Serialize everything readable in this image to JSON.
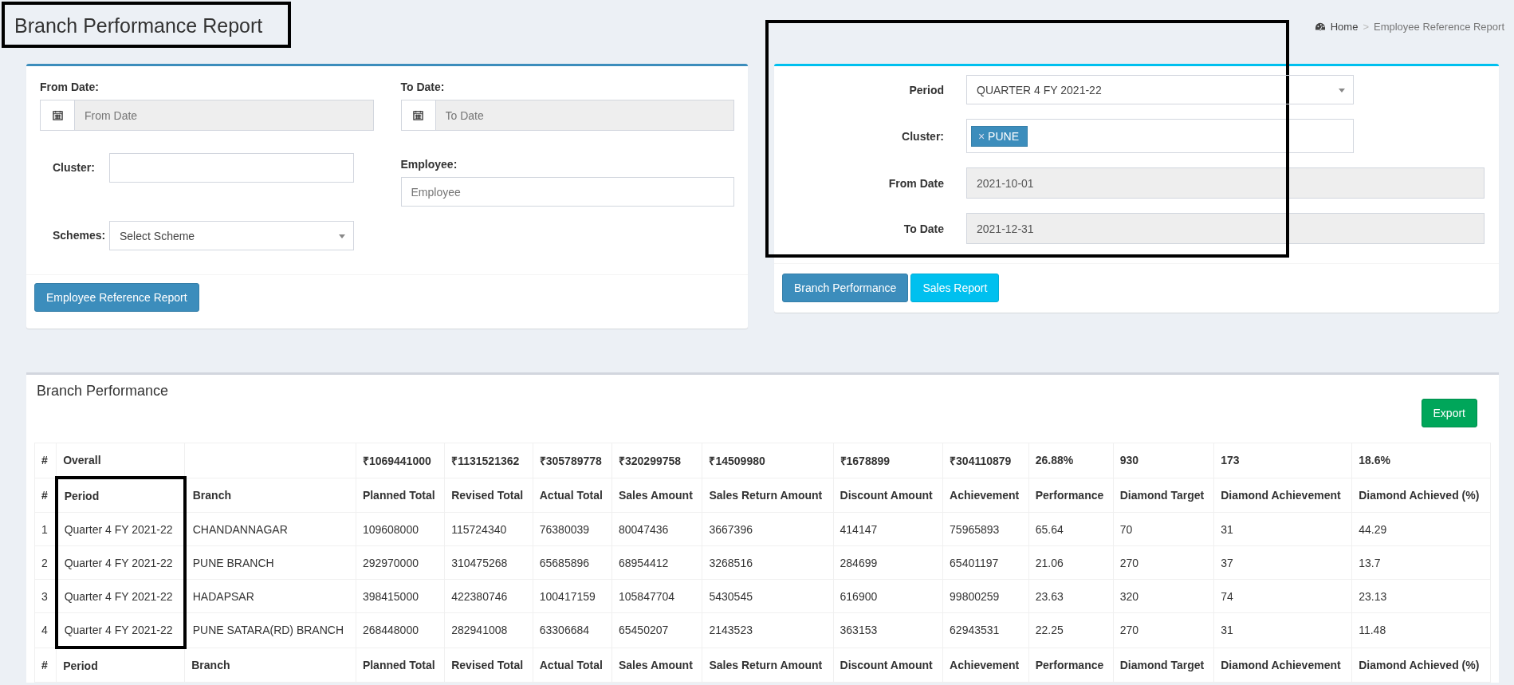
{
  "title": "Branch Performance Report",
  "breadcrumb_separator": ">",
  "breadcrumb": [
    {
      "label": "Home",
      "kind": "home"
    },
    {
      "label": "Employee Reference Report",
      "kind": "current"
    }
  ],
  "filter_panel": {
    "from_date": {
      "label": "From Date:",
      "placeholder": "From Date"
    },
    "to_date": {
      "label": "To Date:",
      "placeholder": "To Date"
    },
    "cluster": {
      "label": "Cluster:"
    },
    "employee": {
      "label": "Employee:",
      "placeholder": "Employee"
    },
    "schemes": {
      "label": "Schemes:",
      "value": "Select Scheme"
    },
    "button": "Employee Reference Report"
  },
  "period_panel": {
    "period": {
      "label": "Period",
      "value": "QUARTER 4 FY 2021-22"
    },
    "cluster": {
      "label": "Cluster:",
      "tags": [
        {
          "remove": "×",
          "label": "PUNE"
        }
      ]
    },
    "from_date": {
      "label": "From Date",
      "value": "2021-10-01"
    },
    "to_date": {
      "label": "To Date",
      "value": "2021-12-31"
    },
    "buttons": [
      {
        "label": "Branch Performance",
        "kind": "primary"
      },
      {
        "label": "Sales Report",
        "kind": "info"
      }
    ]
  },
  "report": {
    "title": "Branch Performance",
    "export": "Export",
    "overall": {
      "hash": "#",
      "label": "Overall",
      "values": [
        "₹1069441000",
        "₹1131521362",
        "₹305789778",
        "₹320299758",
        "₹14509980",
        "₹1678899",
        "₹304110879",
        "26.88%",
        "930",
        "173",
        "18.6%"
      ]
    },
    "columns": [
      "#",
      "Period",
      "Branch",
      "Planned Total",
      "Revised Total",
      "Actual Total",
      "Sales Amount",
      "Sales Return Amount",
      "Discount Amount",
      "Achievement",
      "Performance",
      "Diamond Target",
      "Diamond Achievement",
      "Diamond Achieved (%)"
    ],
    "rows": [
      [
        "1",
        "Quarter 4 FY 2021-22",
        "CHANDANNAGAR",
        "109608000",
        "115724340",
        "76380039",
        "80047436",
        "3667396",
        "414147",
        "75965893",
        "65.64",
        "70",
        "31",
        "44.29"
      ],
      [
        "2",
        "Quarter 4 FY 2021-22",
        "PUNE BRANCH",
        "292970000",
        "310475268",
        "65685896",
        "68954412",
        "3268516",
        "284699",
        "65401197",
        "21.06",
        "270",
        "37",
        "13.7"
      ],
      [
        "3",
        "Quarter 4 FY 2021-22",
        "HADAPSAR",
        "398415000",
        "422380746",
        "100417159",
        "105847704",
        "5430545",
        "616900",
        "99800259",
        "23.63",
        "320",
        "74",
        "23.13"
      ],
      [
        "4",
        "Quarter 4 FY 2021-22",
        "PUNE SATARA(RD) BRANCH",
        "268448000",
        "282941008",
        "63306684",
        "65450207",
        "2143523",
        "363153",
        "62943531",
        "22.25",
        "270",
        "31",
        "11.48"
      ]
    ],
    "footer_columns": [
      "#",
      "Period",
      "Branch",
      "Planned Total",
      "Revised Total",
      "Actual Total",
      "Sales Amount",
      "Sales Return Amount",
      "Discount Amount",
      "Achievement",
      "Performance",
      "Diamond Target",
      "Diamond Achievement",
      "Diamond Achieved (%)"
    ]
  }
}
